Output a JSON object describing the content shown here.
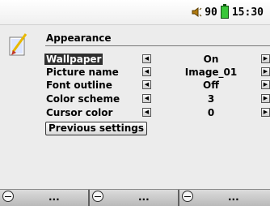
{
  "status": {
    "volume": "90",
    "time": "15:30"
  },
  "panel": {
    "title": "Appearance"
  },
  "settings": [
    {
      "label": "Wallpaper",
      "value": "On",
      "selected": true
    },
    {
      "label": "Picture name",
      "value": "Image_01",
      "selected": false
    },
    {
      "label": "Font outline",
      "value": "Off",
      "selected": false
    },
    {
      "label": "Color scheme",
      "value": "3",
      "selected": false
    },
    {
      "label": "Cursor color",
      "value": "0",
      "selected": false
    }
  ],
  "buttons": {
    "previous_settings": "Previous settings"
  },
  "footer": {
    "softkeys": [
      {
        "label": "..."
      },
      {
        "label": "..."
      },
      {
        "label": "..."
      }
    ]
  },
  "colors": {
    "selection": "#2f2f2f",
    "battery": "#39c639",
    "background": "#ececec"
  },
  "icons": [
    "speaker-icon",
    "battery-icon",
    "appearance-paint-icon",
    "arrow-left-icon",
    "arrow-right-icon",
    "softkey-circle-icon"
  ]
}
